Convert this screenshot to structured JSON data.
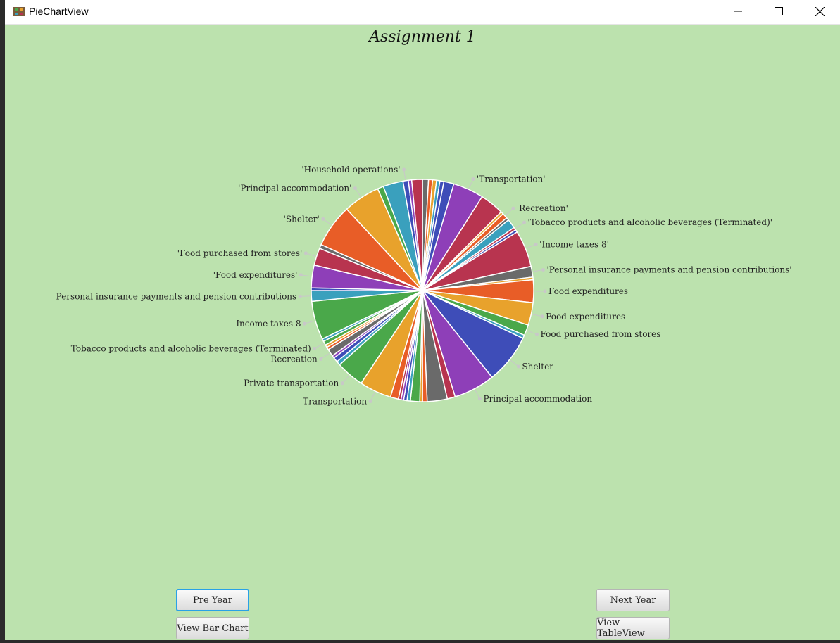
{
  "window": {
    "title": "PieChartView",
    "icon": "app-icon"
  },
  "chart_data": {
    "type": "pie",
    "title": "Assignment 1",
    "legend": "none",
    "slices": [
      {
        "label": "",
        "value": 0.9,
        "color": "#6a6a6a"
      },
      {
        "label": "",
        "value": 0.6,
        "color": "#e85d27"
      },
      {
        "label": "",
        "value": 0.6,
        "color": "#e8a22c"
      },
      {
        "label": "",
        "value": 0.5,
        "color": "#3aa0bd"
      },
      {
        "label": "",
        "value": 0.6,
        "color": "#3e4db8"
      },
      {
        "label": "",
        "value": 1.5,
        "color": "#3e4db8"
      },
      {
        "label": "'Transportation'",
        "value": 4.6,
        "color": "#8e3fb8"
      },
      {
        "label": "",
        "value": 3.6,
        "color": "#b8344f"
      },
      {
        "label": "",
        "value": 0.4,
        "color": "#e8a22c"
      },
      {
        "label": "'Recreation'",
        "value": 0.8,
        "color": "#e85d27"
      },
      {
        "label": "",
        "value": 0.4,
        "color": "#6a6a6a"
      },
      {
        "label": "",
        "value": 1.4,
        "color": "#3aa0bd"
      },
      {
        "label": "'Tobacco products and alcoholic beverages (Terminated)'",
        "value": 0.4,
        "color": "#b8344f"
      },
      {
        "label": "",
        "value": 0.4,
        "color": "#3e4db8"
      },
      {
        "label": "'Income taxes 8'",
        "value": 5.5,
        "color": "#b8344f"
      },
      {
        "label": "'Personal insurance payments and pension contributions'",
        "value": 1.6,
        "color": "#6a6a6a"
      },
      {
        "label": "",
        "value": 0.4,
        "color": "#e8a22c"
      },
      {
        "label": "Food expenditures",
        "value": 3.4,
        "color": "#e85d27"
      },
      {
        "label": "Food expenditures",
        "value": 3.4,
        "color": "#e8a22c"
      },
      {
        "label": "Food purchased from stores",
        "value": 1.6,
        "color": "#4aa84a"
      },
      {
        "label": "",
        "value": 0.5,
        "color": "#3aa0bd"
      },
      {
        "label": "Shelter",
        "value": 7.4,
        "color": "#3e4db8"
      },
      {
        "label": "Principal accommodation",
        "value": 6.2,
        "color": "#8e3fb8"
      },
      {
        "label": "",
        "value": 1.2,
        "color": "#b8344f"
      },
      {
        "label": "",
        "value": 3.0,
        "color": "#6a6a6a"
      },
      {
        "label": "",
        "value": 0.7,
        "color": "#e85d27"
      },
      {
        "label": "",
        "value": 0.4,
        "color": "#e8a22c"
      },
      {
        "label": "",
        "value": 1.4,
        "color": "#4aa84a"
      },
      {
        "label": "",
        "value": 0.5,
        "color": "#3aa0bd"
      },
      {
        "label": "",
        "value": 0.5,
        "color": "#3e4db8"
      },
      {
        "label": "",
        "value": 0.4,
        "color": "#8e3fb8"
      },
      {
        "label": "",
        "value": 0.4,
        "color": "#b8344f"
      },
      {
        "label": "",
        "value": 1.2,
        "color": "#e85d27"
      },
      {
        "label": "Transportation",
        "value": 4.8,
        "color": "#e8a22c"
      },
      {
        "label": "Private transportation",
        "value": 4.2,
        "color": "#4aa84a"
      },
      {
        "label": "",
        "value": 0.6,
        "color": "#3aa0bd"
      },
      {
        "label": "",
        "value": 0.7,
        "color": "#3e4db8"
      },
      {
        "label": "",
        "value": 0.4,
        "color": "#8e3fb8"
      },
      {
        "label": "Recreation",
        "value": 1.1,
        "color": "#6a6a6a"
      },
      {
        "label": "",
        "value": 0.4,
        "color": "#e85d27"
      },
      {
        "label": "",
        "value": 0.4,
        "color": "#e8a22c"
      },
      {
        "label": "Tobacco products and alcoholic beverages (Terminated)",
        "value": 0.6,
        "color": "#4aa84a"
      },
      {
        "label": "",
        "value": 0.4,
        "color": "#3aa0bd"
      },
      {
        "label": "Income taxes 8",
        "value": 5.8,
        "color": "#4aa84a"
      },
      {
        "label": "Personal insurance payments and pension contributions",
        "value": 1.6,
        "color": "#3aa0bd"
      },
      {
        "label": "",
        "value": 0.4,
        "color": "#3e4db8"
      },
      {
        "label": "'Food expenditures'",
        "value": 3.4,
        "color": "#8e3fb8"
      },
      {
        "label": "'Food purchased from stores'",
        "value": 2.6,
        "color": "#b8344f"
      },
      {
        "label": "",
        "value": 0.6,
        "color": "#6a6a6a"
      },
      {
        "label": "'Shelter'",
        "value": 6.5,
        "color": "#e85d27"
      },
      {
        "label": "'Principal accommodation'",
        "value": 5.5,
        "color": "#e8a22c"
      },
      {
        "label": "",
        "value": 0.9,
        "color": "#4aa84a"
      },
      {
        "label": "",
        "value": 3.0,
        "color": "#3aa0bd"
      },
      {
        "label": "'Household operations'",
        "value": 0.8,
        "color": "#3e4db8"
      },
      {
        "label": "",
        "value": 0.5,
        "color": "#8e3fb8"
      },
      {
        "label": "",
        "value": 1.6,
        "color": "#b8344f"
      }
    ]
  },
  "buttons": {
    "pre_year": "Pre Year",
    "view_bar_chart": "View Bar Chart",
    "next_year": "Next Year",
    "view_table_view": "View TableView"
  }
}
